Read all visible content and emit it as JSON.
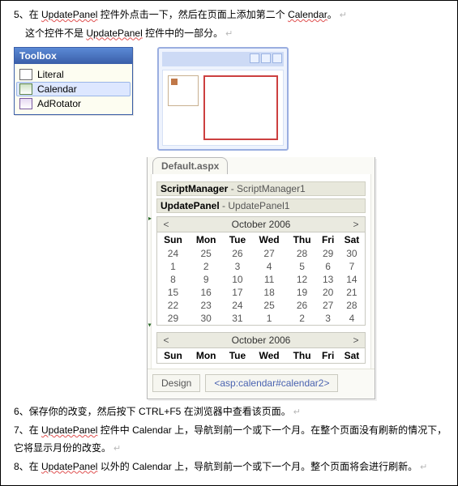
{
  "step5": {
    "line1_prefix": "5、在 ",
    "line1_kw": "UpdatePanel",
    "line1_mid": " 控件外点击一下，然后在页面上添加第二个 ",
    "line1_kw2": "Calendar",
    "line1_suffix": "。",
    "line2_prefix": "这个控件不是 ",
    "line2_kw": "UpdatePanel",
    "line2_suffix": " 控件中的一部分。"
  },
  "toolbox": {
    "title": "Toolbox",
    "items": [
      {
        "name": "Literal",
        "icon": "literal",
        "selected": false
      },
      {
        "name": "Calendar",
        "icon": "calendar",
        "selected": true
      },
      {
        "name": "AdRotator",
        "icon": "adrot",
        "selected": false
      }
    ]
  },
  "aspx": {
    "filename": "Default.aspx",
    "script_manager": {
      "bold": "ScriptManager",
      "rest": " - ScriptManager1"
    },
    "update_panel": {
      "bold": "UpdatePanel",
      "rest": " - UpdatePanel1"
    },
    "bottom": {
      "design": "Design",
      "tagpath": "<asp:calendar#calendar2>"
    }
  },
  "calendar": {
    "nav_prev": "<",
    "nav_next": ">",
    "title": "October 2006",
    "dow": [
      "Sun",
      "Mon",
      "Tue",
      "Wed",
      "Thu",
      "Fri",
      "Sat"
    ],
    "rows": [
      [
        "24",
        "25",
        "26",
        "27",
        "28",
        "29",
        "30"
      ],
      [
        "1",
        "2",
        "3",
        "4",
        "5",
        "6",
        "7"
      ],
      [
        "8",
        "9",
        "10",
        "11",
        "12",
        "13",
        "14"
      ],
      [
        "15",
        "16",
        "17",
        "18",
        "19",
        "20",
        "21"
      ],
      [
        "22",
        "23",
        "24",
        "25",
        "26",
        "27",
        "28"
      ],
      [
        "29",
        "30",
        "31",
        "1",
        "2",
        "3",
        "4"
      ]
    ]
  },
  "step6": "6、保存你的改变，然后按下 CTRL+F5 在浏览器中查看该页面。",
  "step7": {
    "prefix": "7、在 ",
    "kw": "UpdatePanel",
    "mid": " 控件中 Calendar 上，导航到前一个或下一个月。在整个页面没有刷新的情况下，",
    "line2": "它将显示月份的改变。"
  },
  "step8": {
    "prefix": "8、在 ",
    "kw": "UpdatePanel",
    "suffix": " 以外的 Calendar 上，导航到前一个或下一个月。整个页面将会进行刷新。"
  },
  "ret": "↵"
}
